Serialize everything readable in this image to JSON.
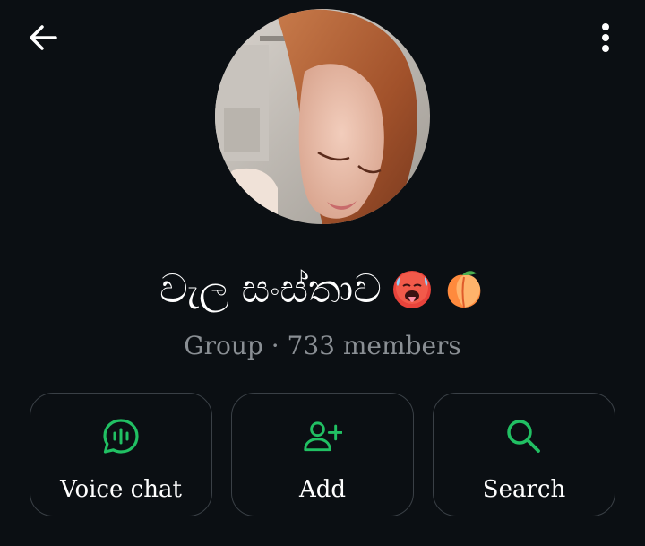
{
  "header": {
    "back_icon": "arrow-left-icon",
    "menu_icon": "more-vertical-icon"
  },
  "group": {
    "name": "වැල සංස්තාව",
    "emojis": [
      "hot-face-emoji",
      "peach-emoji"
    ],
    "subtitle": "Group · 733 members"
  },
  "actions": [
    {
      "label": "Voice chat",
      "icon": "voice-chat-icon"
    },
    {
      "label": "Add",
      "icon": "add-person-icon"
    },
    {
      "label": "Search",
      "icon": "search-icon"
    }
  ],
  "colors": {
    "background": "#0b0f13",
    "accent": "#21c063",
    "subtitle": "#8a8f94",
    "border": "#3a4046"
  }
}
